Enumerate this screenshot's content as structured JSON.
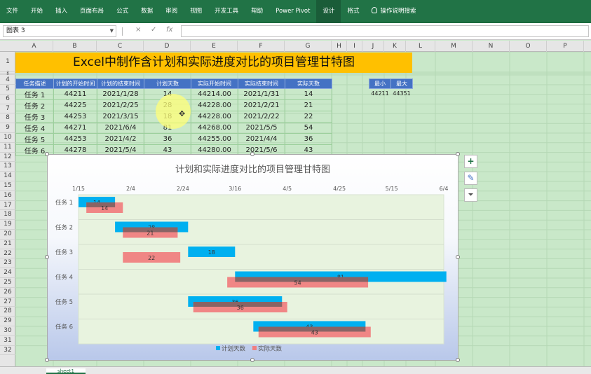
{
  "ribbon": {
    "tabs": [
      "文件",
      "开始",
      "插入",
      "页面布局",
      "公式",
      "数据",
      "审阅",
      "视图",
      "开发工具",
      "帮助",
      "Power Pivot",
      "设计",
      "格式"
    ],
    "active_tab": "设计",
    "search_label": "操作说明搜索"
  },
  "formula_bar": {
    "name_box": "图表 3",
    "cancel_glyph": "×",
    "enter_glyph": "✓",
    "fx_glyph": "fx",
    "formula_value": ""
  },
  "grid": {
    "columns": [
      "A",
      "B",
      "C",
      "D",
      "E",
      "F",
      "G",
      "H",
      "I",
      "J",
      "K",
      "L",
      "M",
      "N",
      "O",
      "P"
    ],
    "rows": [
      "1",
      "2",
      "3",
      "4",
      "5",
      "6",
      "7",
      "8",
      "9",
      "10",
      "11",
      "12",
      "13",
      "14",
      "15",
      "16",
      "17",
      "18",
      "19",
      "20",
      "21",
      "22",
      "23",
      "24",
      "25",
      "26",
      "27",
      "28",
      "29",
      "30",
      "31",
      "32"
    ]
  },
  "banner": {
    "title": "Excel中制作含计划和实际进度对比的项目管理甘特图"
  },
  "table": {
    "headers": [
      "任务描述",
      "计划的开始时间",
      "计划的结束时间",
      "计划天数",
      "实际开始时间",
      "实际结束时间",
      "实际天数"
    ],
    "rows": [
      [
        "任务 1",
        "44211",
        "2021/1/28",
        "14",
        "44214.00",
        "2021/1/31",
        "14"
      ],
      [
        "任务 2",
        "44225",
        "2021/2/25",
        "28",
        "44228.00",
        "2021/2/21",
        "21"
      ],
      [
        "任务 3",
        "44253",
        "2021/3/15",
        "18",
        "44228.00",
        "2021/2/22",
        "22"
      ],
      [
        "任务 4",
        "44271",
        "2021/6/4",
        "81",
        "44268.00",
        "2021/5/5",
        "54"
      ],
      [
        "任务 5",
        "44253",
        "2021/4/2",
        "36",
        "44255.00",
        "2021/4/4",
        "36"
      ],
      [
        "任务 6",
        "44278",
        "2021/5/4",
        "43",
        "44280.00",
        "2021/5/6",
        "43"
      ]
    ]
  },
  "minmax": {
    "headers": [
      "最小",
      "最大"
    ],
    "values": [
      "44211",
      "44351"
    ]
  },
  "chart_data": {
    "type": "bar",
    "title": "计划和实际进度对比的项目管理甘特图",
    "categories": [
      "任务 1",
      "任务 2",
      "任务 3",
      "任务 4",
      "任务 5",
      "任务 6"
    ],
    "x_tick_labels": [
      "1/15",
      "2/4",
      "2/24",
      "3/16",
      "4/5",
      "4/25",
      "5/15",
      "6/4"
    ],
    "x_range": [
      44211,
      44351
    ],
    "series": [
      {
        "name": "计划天数",
        "color": "#00b0f0",
        "start": [
          44211,
          44225,
          44253,
          44271,
          44253,
          44278
        ],
        "values": [
          14,
          28,
          18,
          81,
          36,
          43
        ]
      },
      {
        "name": "实际天数",
        "color": "#f08080",
        "start": [
          44214,
          44228,
          44228,
          44268,
          44255,
          44280
        ],
        "values": [
          14,
          21,
          22,
          54,
          36,
          43
        ]
      }
    ],
    "legend_position": "bottom"
  },
  "sheet": {
    "tab": "sheet1"
  }
}
